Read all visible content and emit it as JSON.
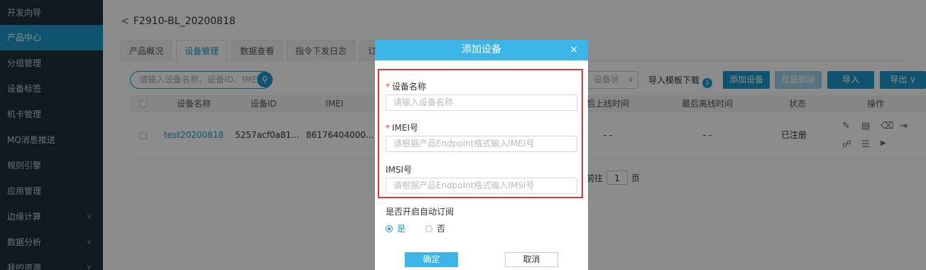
{
  "sidebar": {
    "items": [
      {
        "label": "开发向导"
      },
      {
        "label": "产品中心"
      },
      {
        "label": "分组管理"
      },
      {
        "label": "设备标签"
      },
      {
        "label": "机卡管理"
      },
      {
        "label": "MQ消息推送"
      },
      {
        "label": "规则引擎"
      },
      {
        "label": "应用管理"
      },
      {
        "label": "边缘计算"
      },
      {
        "label": "数据分析"
      },
      {
        "label": "我的资源"
      }
    ],
    "active_index": 1
  },
  "header": {
    "back_title": "F2910-BL_20200818"
  },
  "tabs": [
    {
      "label": "产品概况"
    },
    {
      "label": "设备管理"
    },
    {
      "label": "数据查看"
    },
    {
      "label": "指令下发日志"
    },
    {
      "label": "订"
    }
  ],
  "toolbar": {
    "search_placeholder": "请输入设备名称、设备ID、IME",
    "state_placeholder": "设备状",
    "template_download": "导入模板下载",
    "add_device": "添加设备",
    "batch_delete": "批量删除",
    "import": "导入",
    "export": "导出"
  },
  "table": {
    "columns": [
      "设备名称",
      "设备ID",
      "IMEI",
      "后上线时间",
      "最后离线时间",
      "状态",
      "操作"
    ],
    "rows": [
      {
        "name": "test20200818",
        "id": "5257acf0a81...",
        "imei": "86176404000...",
        "online": "- -",
        "offline": "- -",
        "status": "已注册"
      }
    ]
  },
  "pager": {
    "goto": "前往",
    "page": "1",
    "suffix": "页"
  },
  "dialog": {
    "title": "添加设备",
    "close": "×",
    "fields": [
      {
        "label": "设备名称",
        "required": "*",
        "placeholder": "请输入设备名称"
      },
      {
        "label": "IMEI号",
        "required": "*",
        "placeholder": "请根据产品Endpoint格式输入IMEI号"
      },
      {
        "label": "IMSI号",
        "placeholder": "请根据产品Endpoint格式输入IMSI号"
      }
    ],
    "subscribe_label": "是否开启自动订阅",
    "radio_yes": "是",
    "radio_no": "否",
    "confirm": "确定",
    "cancel": "取消"
  }
}
